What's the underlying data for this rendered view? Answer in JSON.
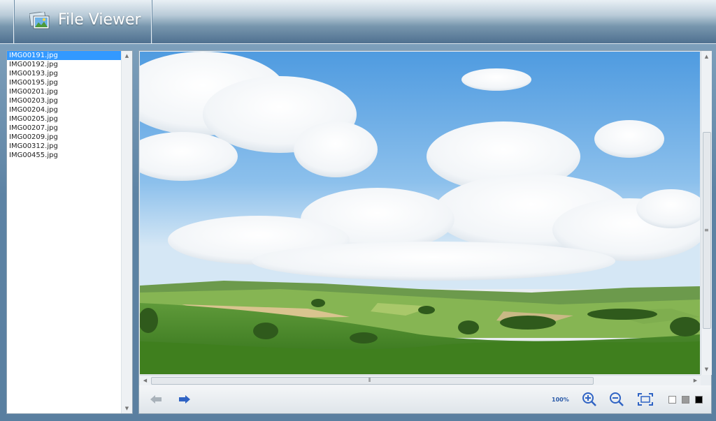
{
  "app": {
    "title": "File Viewer"
  },
  "files": [
    "IMG00191.jpg",
    "IMG00192.jpg",
    "IMG00193.jpg",
    "IMG00195.jpg",
    "IMG00201.jpg",
    "IMG00203.jpg",
    "IMG00204.jpg",
    "IMG00205.jpg",
    "IMG00207.jpg",
    "IMG00209.jpg",
    "IMG00312.jpg",
    "IMG00455.jpg"
  ],
  "selected_file_index": 0,
  "toolbar": {
    "zoom_level": "100%",
    "buttons": [
      "arrow-left-icon",
      "arrow-right-icon",
      "zoom-in-icon",
      "zoom-out-icon",
      "fit-to-screen-icon"
    ],
    "background_swatches": [
      "#ffffff",
      "#9a9a9a",
      "#000000"
    ]
  },
  "colors": {
    "selection": "#3399ff",
    "accent": "#2a5aa8"
  }
}
